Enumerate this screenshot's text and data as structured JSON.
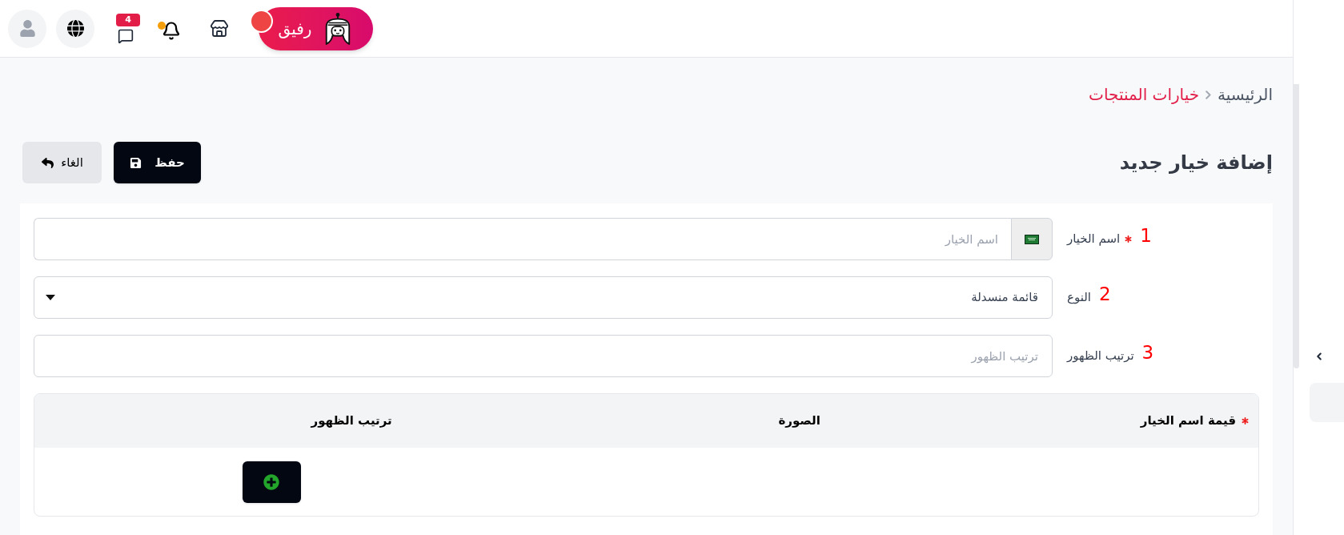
{
  "top_bar": {
    "assistant": {
      "label": "رفيق",
      "alert": true
    },
    "messages": {
      "badge": "4"
    },
    "notifications": {
      "unread": true
    }
  },
  "breadcrumb": [
    {
      "label": "الرئيسية",
      "current": false
    },
    {
      "label": "خيارات المنتجات",
      "current": true
    }
  ],
  "page": {
    "title": "إضافة خيار جديد",
    "actions": [
      {
        "kind": "save",
        "label": "حفظ"
      },
      {
        "kind": "cancel",
        "label": "الغاء"
      }
    ]
  },
  "form": {
    "fields": [
      {
        "kind": "localized",
        "marker": "1",
        "label": "اسم الخيار",
        "required": true,
        "placeholder": "اسم الخيار"
      },
      {
        "kind": "select",
        "marker": "2",
        "label": "النوع",
        "required": false,
        "value": "قائمة منسدلة"
      },
      {
        "kind": "text",
        "marker": "3",
        "label": "ترتيب الظهور",
        "required": false,
        "placeholder": "ترتيب الظهور"
      }
    ]
  },
  "values_table": {
    "columns": [
      {
        "label": "قيمة اسم الخيار",
        "required": true
      },
      {
        "label": "الصورة",
        "required": false
      },
      {
        "label": "ترتيب الظهور",
        "required": false
      }
    ]
  }
}
